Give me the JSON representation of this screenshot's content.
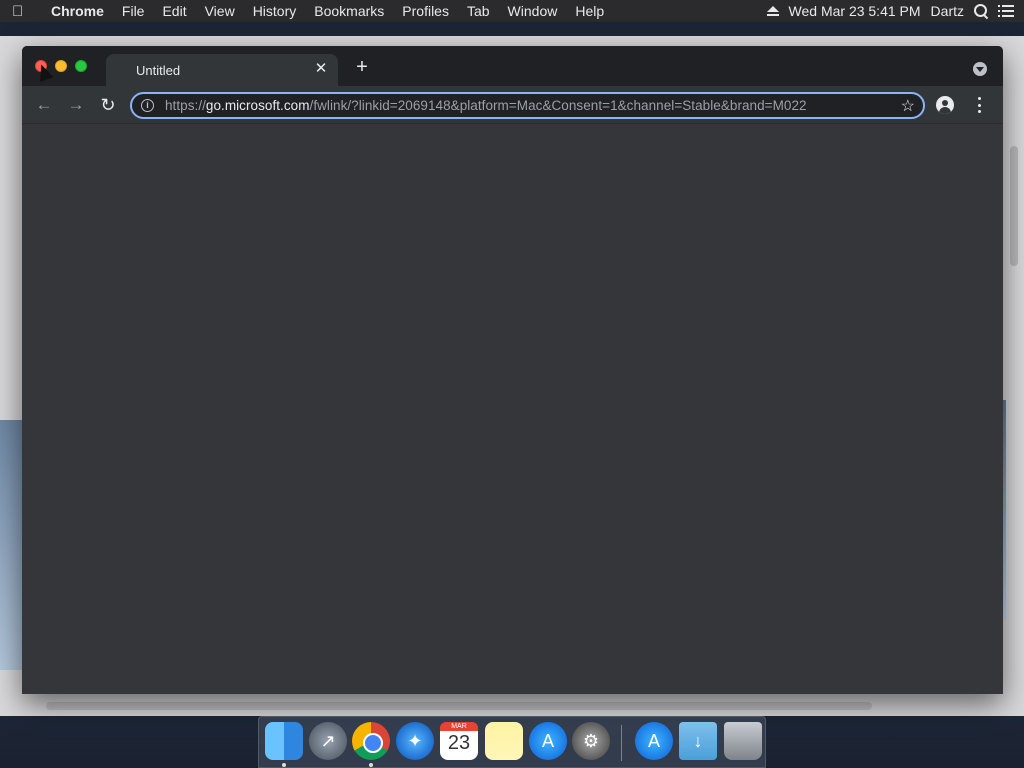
{
  "menubar": {
    "app_name": "Chrome",
    "items": [
      "File",
      "Edit",
      "View",
      "History",
      "Bookmarks",
      "Profiles",
      "Tab",
      "Window",
      "Help"
    ],
    "datetime": "Wed Mar 23  5:41 PM",
    "user": "Dartz"
  },
  "browser": {
    "tab_title": "Untitled",
    "url_prefix": "https://",
    "url_host": "go.microsoft.com",
    "url_rest": "/fwlink/?linkid=2069148&platform=Mac&Consent=1&channel=Stable&brand=M022"
  },
  "dock": {
    "calendar_month": "MAR",
    "calendar_day": "23"
  },
  "colors": {
    "omnibox_focus": "#8ab4f8",
    "tabstrip_bg": "#202124",
    "content_bg": "#35363a"
  }
}
